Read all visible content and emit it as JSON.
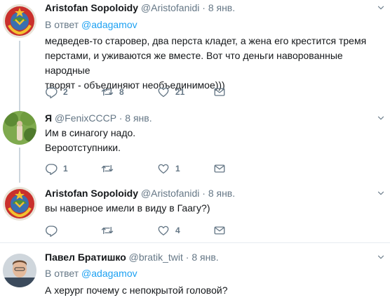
{
  "tweets": [
    {
      "name": "Aristofan Sopoloidy",
      "handle": "@Aristofanidi",
      "dot": "·",
      "time": "8 янв.",
      "reply_prefix": "В ответ",
      "reply_mention": "@adagamov",
      "text_lines": [
        "медведев-то старовер, два перста кладет, а жена его крестится тремя",
        "перстами, и уживаются же вместе. Вот что деньги наворованные народные",
        "творят - объединяют необъединимое)))"
      ],
      "replies": "2",
      "retweets": "8",
      "likes": "21",
      "avatar": "soviet-emblem"
    },
    {
      "name": "Я",
      "handle": "@FenixCCCP",
      "dot": "·",
      "time": "8 янв.",
      "text_lines": [
        "Им в синагогу надо.",
        "Вероотступники."
      ],
      "replies": "1",
      "retweets": "",
      "likes": "1",
      "avatar": "nature-photo"
    },
    {
      "name": "Aristofan Sopoloidy",
      "handle": "@Aristofanidi",
      "dot": "·",
      "time": "8 янв.",
      "text_lines": [
        "вы наверное имели в виду в Гаагу?)"
      ],
      "replies": "",
      "retweets": "",
      "likes": "4",
      "avatar": "soviet-emblem"
    },
    {
      "name": "Павел Братишко",
      "handle": "@bratik_twit",
      "dot": "·",
      "time": "8 янв.",
      "reply_prefix": "В ответ",
      "reply_mention": "@adagamov",
      "text_lines": [
        "А херург почему с непокрытой головой?"
      ],
      "avatar": "man-photo"
    }
  ],
  "icons": {
    "reply": "reply-icon",
    "retweet": "retweet-icon",
    "like": "heart-icon",
    "dm": "envelope-icon",
    "more": "chevron-down-icon"
  },
  "colors": {
    "link": "#1da1f2",
    "muted": "#657786",
    "thread_line": "#ccd6dd"
  }
}
